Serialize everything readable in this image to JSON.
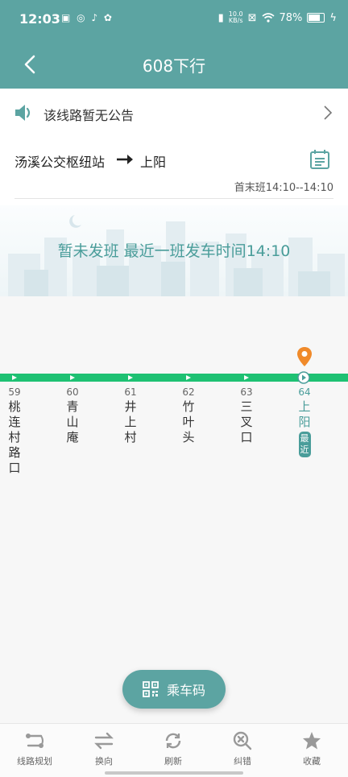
{
  "status_bar": {
    "time": "12:03",
    "left_icons": "▣ ◎ ♪ ✿",
    "net_speed_top": "10.0",
    "net_speed_bottom": "KB/s",
    "battery": "78%"
  },
  "header": {
    "title": "608下行"
  },
  "notice": {
    "text": "该线路暂无公告"
  },
  "route": {
    "from": "汤溪公交枢纽站",
    "to": "上阳",
    "first_last": "首末班14:10--14:10"
  },
  "banner": {
    "text": "暂未发班 最近一班发车时间14:10"
  },
  "stops": [
    {
      "num": "59",
      "name": "桃连村路口"
    },
    {
      "num": "60",
      "name": "青山庵"
    },
    {
      "num": "61",
      "name": "井上村"
    },
    {
      "num": "62",
      "name": "竹叶头"
    },
    {
      "num": "63",
      "name": "三叉口"
    },
    {
      "num": "64",
      "name": "上阳",
      "badge": "最近"
    }
  ],
  "ride_code": {
    "label": "乘车码"
  },
  "bottom_nav": [
    {
      "label": "线路规划",
      "icon": "route-plan-icon"
    },
    {
      "label": "换向",
      "icon": "swap-icon"
    },
    {
      "label": "刷新",
      "icon": "refresh-icon"
    },
    {
      "label": "纠错",
      "icon": "report-error-icon"
    },
    {
      "label": "收藏",
      "icon": "star-icon"
    }
  ],
  "colors": {
    "brand": "#5ca4a2",
    "route_line": "#1ec173",
    "pin": "#f08a2a"
  }
}
